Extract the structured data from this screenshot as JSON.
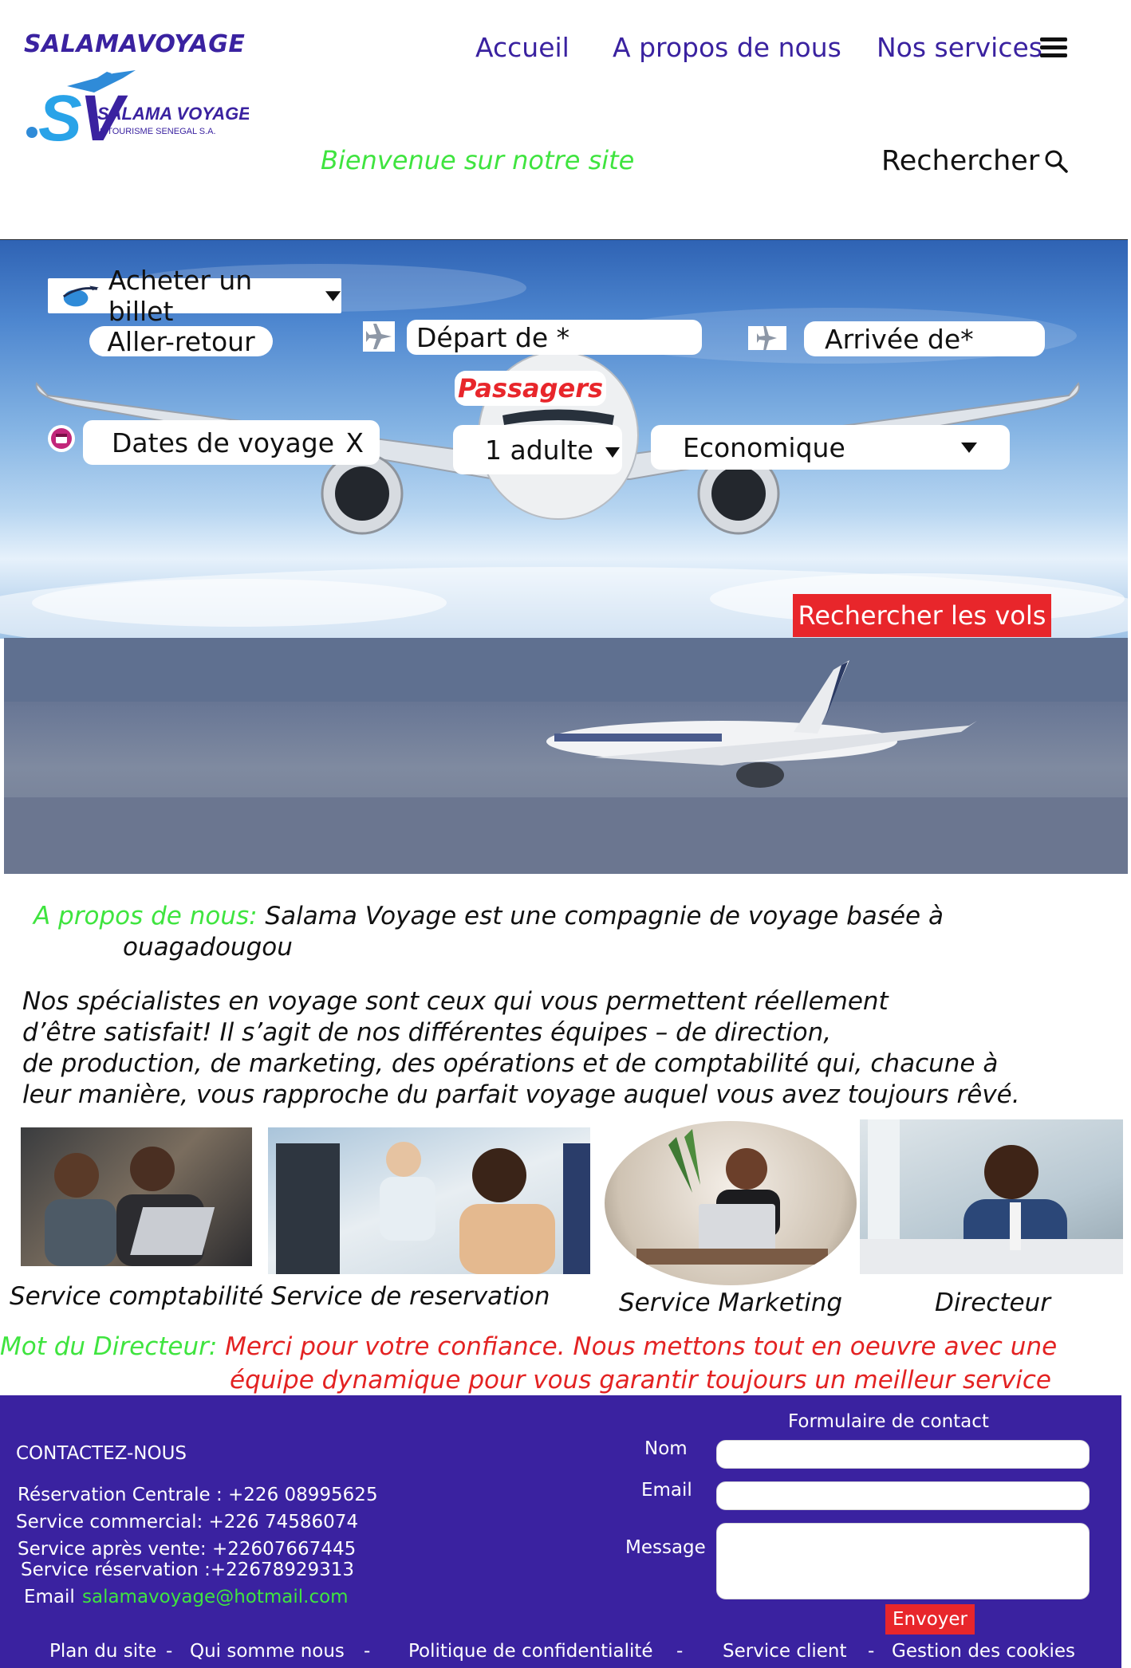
{
  "header": {
    "brand": "SALAMAVOYAGE",
    "logo_text": "SALAMA VOYAGE",
    "logo_sub": "& TOURISME SENEGAL S.A.",
    "nav": [
      "Accueil",
      "A propos de nous",
      "Nos services"
    ],
    "welcome": "Bienvenue sur notre site",
    "search_label": "Rechercher"
  },
  "booking": {
    "ticket_label": "Acheter un billet",
    "trip_type": "Aller-retour",
    "departure_placeholder": "Départ de *",
    "arrival_placeholder": "Arrivée de*",
    "passengers_heading": "Passagers",
    "dates_placeholder": "Dates de voyage",
    "dates_clear": "X",
    "passengers_value": "1 adulte",
    "class_value": "Economique",
    "search_button": "Rechercher les vols"
  },
  "about": {
    "label": "A propos de nous:",
    "line1": "Salama Voyage est une compagnie de voyage basée à",
    "line2": "ouagadougou",
    "paragraph": [
      "Nos spécialistes en voyage sont ceux qui vous permettent réellement",
      "d’être satisfait! Il s’agit de nos différentes équipes – de direction,",
      "de production, de marketing, des opérations et de comptabilité qui, chacune à",
      "leur manière, vous rapproche du parfait voyage auquel vous avez toujours rêvé."
    ]
  },
  "teams": [
    {
      "caption": "Service comptabilité"
    },
    {
      "caption": "Service de reservation"
    },
    {
      "caption": "Service Marketing"
    },
    {
      "caption": "Directeur"
    }
  ],
  "director": {
    "label": "Mot du Directeur:",
    "line1": "Merci pour votre confiance. Nous mettons tout en oeuvre avec une",
    "line2": "équipe dynamique pour vous garantir toujours un meilleur service"
  },
  "footer": {
    "contact_title": "CONTACTEZ-NOUS",
    "contacts": [
      "Réservation Centrale : +226 08995625",
      "Service commercial: +226 74586074",
      "Service après vente: +22607667445",
      "Service réservation :+22678929313"
    ],
    "email_label": "Email",
    "email_value": "salamavoyage@hotmail.com",
    "form_title": "Formulaire de contact",
    "form_name_label": "Nom",
    "form_email_label": "Email",
    "form_message_label": "Message",
    "form_submit": "Envoyer",
    "links": [
      "Plan du site",
      "Qui somme nous",
      "Politique de confidentialité",
      "Service client",
      "Gestion des cookies"
    ],
    "separator": "-"
  },
  "colors": {
    "brand_purple": "#3a22a0",
    "accent_green": "#3fe43f",
    "accent_red": "#e8262b",
    "director_red": "#e32222"
  }
}
